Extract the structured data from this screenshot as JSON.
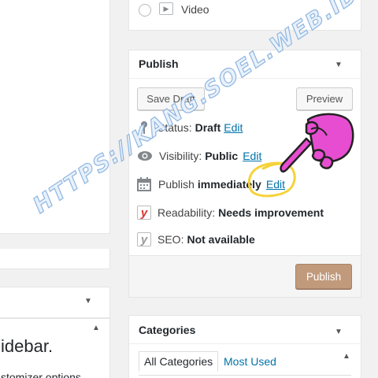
{
  "format_options": {
    "video_label": "Video"
  },
  "publish": {
    "title": "Publish",
    "save_draft": "Save Draft",
    "preview": "Preview",
    "status_label": "Status:",
    "status_value": "Draft",
    "visibility_label": "Visibility:",
    "visibility_value": "Public",
    "publish_label": "Publish",
    "publish_value": "immediately",
    "edit": "Edit",
    "readability_label": "Readability:",
    "readability_value": "Needs improvement",
    "seo_label": "SEO:",
    "seo_value": "Not available",
    "publish_button": "Publish"
  },
  "categories": {
    "title": "Categories",
    "tab_all": "All Categories",
    "tab_most_used": "Most Used"
  },
  "left_panel": {
    "heading_fragment": "idebar.",
    "text_fragment": "stomizer options"
  },
  "watermark": {
    "text": "HTTPS://KANG.SOEL.WEB.ID"
  },
  "colors": {
    "link": "#0073aa",
    "publish_button": "#c19a7c",
    "annotation_hand": "#e64dd0",
    "annotation_circle": "#f5d23a",
    "yoast_red": "#dc3232"
  }
}
